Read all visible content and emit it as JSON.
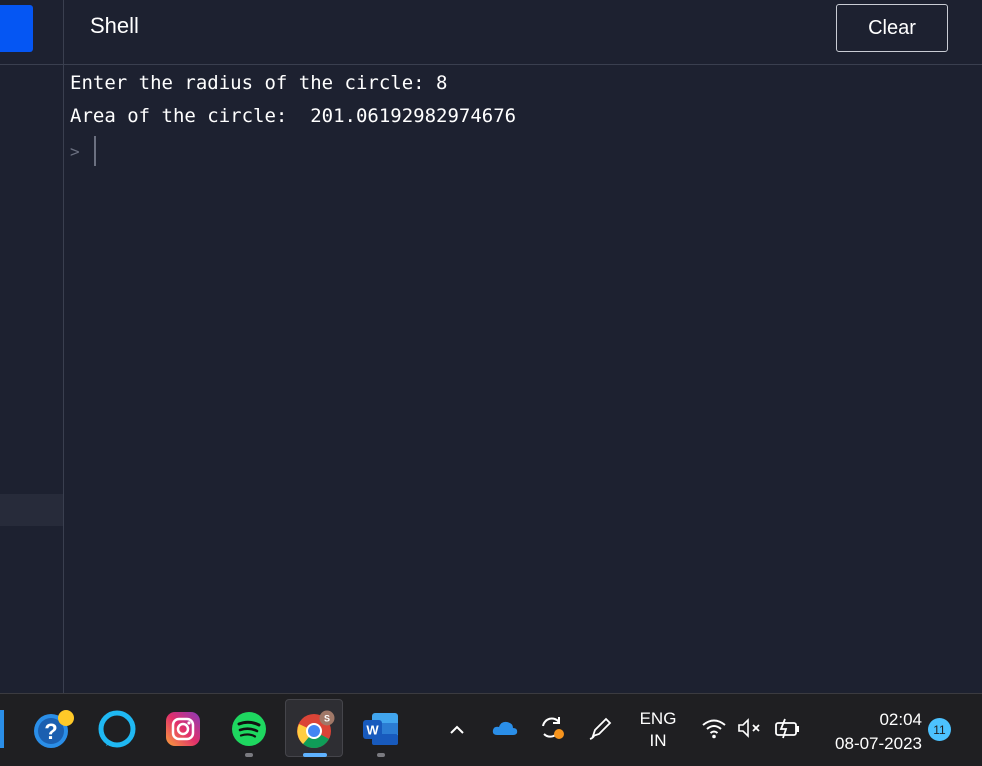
{
  "shell": {
    "title": "Shell",
    "clear_label": "Clear",
    "output": [
      "Enter the radius of the circle: 8",
      "Area of the circle:  201.06192982974676"
    ],
    "prompt": ">"
  },
  "taskbar": {
    "apps": [
      {
        "name": "help",
        "icon": "help-icon"
      },
      {
        "name": "alexa",
        "icon": "alexa-icon"
      },
      {
        "name": "instagram",
        "icon": "instagram-icon"
      },
      {
        "name": "spotify",
        "icon": "spotify-icon"
      },
      {
        "name": "chrome",
        "icon": "chrome-icon",
        "active": true,
        "badge": "S"
      },
      {
        "name": "word",
        "icon": "word-icon",
        "letter": "W"
      }
    ],
    "tray": {
      "language_top": "ENG",
      "language_bottom": "IN",
      "time": "02:04",
      "date": "08-07-2023",
      "notification_count": "11"
    }
  },
  "colors": {
    "background": "#1d2130",
    "accent": "#0556f3",
    "taskbar": "#1f1f22"
  }
}
